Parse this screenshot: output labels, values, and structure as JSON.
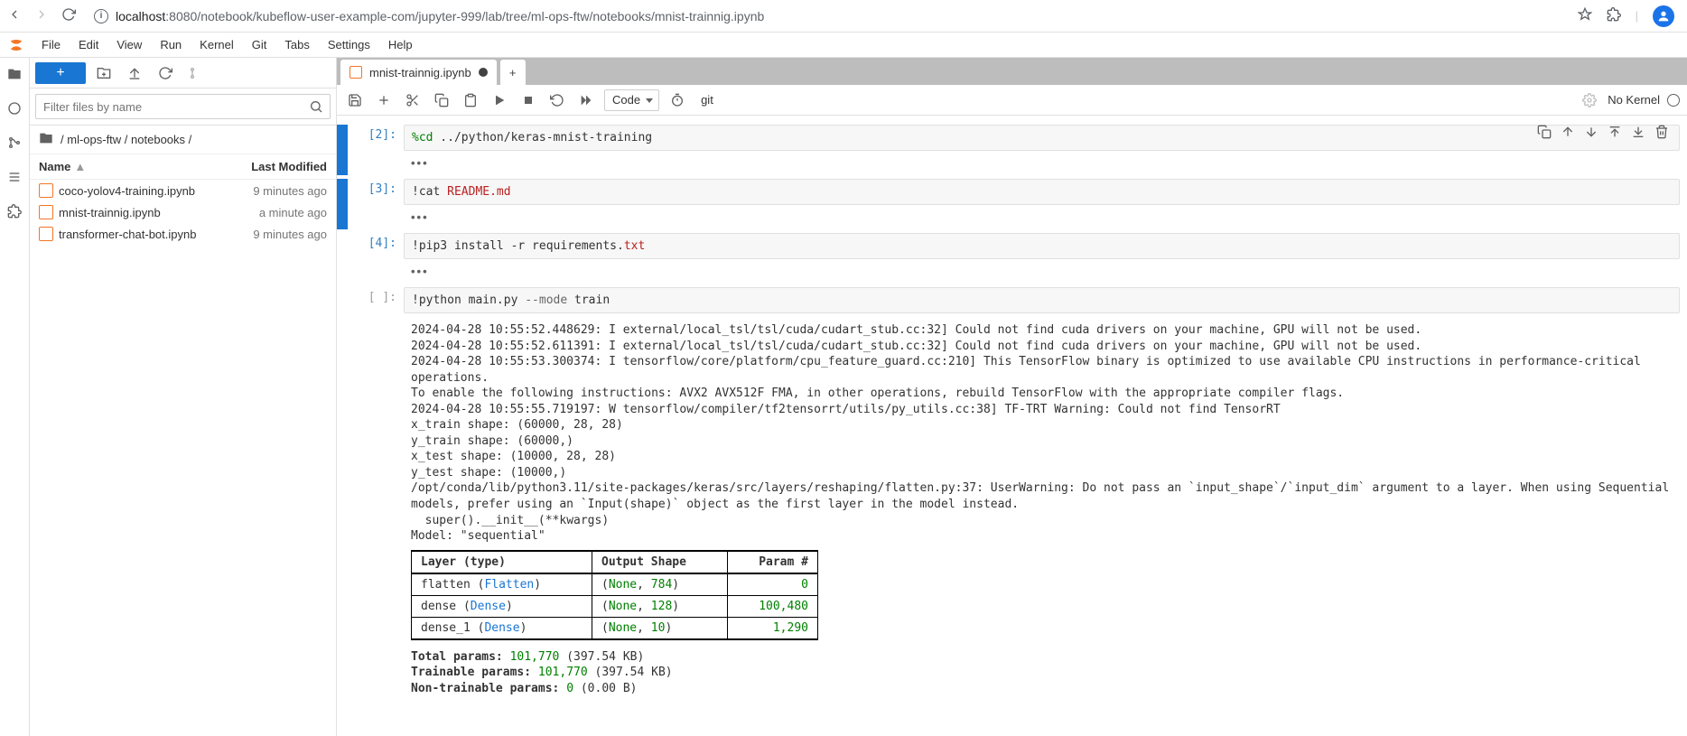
{
  "browser": {
    "url_host": "localhost",
    "url_port_path": ":8080/notebook/kubeflow-user-example-com/jupyter-999/lab/tree/ml-ops-ftw/notebooks/mnist-trainnig.ipynb"
  },
  "menubar": {
    "items": [
      "File",
      "Edit",
      "View",
      "Run",
      "Kernel",
      "Git",
      "Tabs",
      "Settings",
      "Help"
    ]
  },
  "file_panel": {
    "filter_placeholder": "Filter files by name",
    "breadcrumb_parts": [
      "/",
      "ml-ops-ftw",
      "/",
      "notebooks",
      "/"
    ],
    "header_name": "Name",
    "header_modified": "Last Modified",
    "items": [
      {
        "name": "coco-yolov4-training.ipynb",
        "modified": "9 minutes ago"
      },
      {
        "name": "mnist-trainnig.ipynb",
        "modified": "a minute ago"
      },
      {
        "name": "transformer-chat-bot.ipynb",
        "modified": "9 minutes ago"
      }
    ]
  },
  "tab": {
    "title": "mnist-trainnig.ipynb"
  },
  "nb_toolbar": {
    "cell_type": "Code",
    "git_label": "git",
    "kernel_status": "No Kernel"
  },
  "cells": [
    {
      "prompt": "[2]:",
      "code_html": "<span class='cm-magic'>%cd</span> ../python/keras-mnist-training",
      "collapsed": true
    },
    {
      "prompt": "[3]:",
      "code_html": "<span class='cm-bang'>!</span>cat <span class='cm-str'>README.md</span>",
      "collapsed": true
    },
    {
      "prompt": "[4]:",
      "code_html": "<span class='cm-bang'>!</span>pip3 install -r requirements.<span class='cm-str'>txt</span>",
      "collapsed": true
    },
    {
      "prompt": "[ ]:",
      "code_html": "<span class='cm-bang'>!</span>python main.py <span class='cm-opt'>--mode</span> train",
      "collapsed": false
    }
  ],
  "output_lines_pre": "2024-04-28 10:55:52.448629: I external/local_tsl/tsl/cuda/cudart_stub.cc:32] Could not find cuda drivers on your machine, GPU will not be used.\n2024-04-28 10:55:52.611391: I external/local_tsl/tsl/cuda/cudart_stub.cc:32] Could not find cuda drivers on your machine, GPU will not be used.\n2024-04-28 10:55:53.300374: I tensorflow/core/platform/cpu_feature_guard.cc:210] This TensorFlow binary is optimized to use available CPU instructions in performance-critical operations.\nTo enable the following instructions: AVX2 AVX512F FMA, in other operations, rebuild TensorFlow with the appropriate compiler flags.\n2024-04-28 10:55:55.719197: W tensorflow/compiler/tf2tensorrt/utils/py_utils.cc:38] TF-TRT Warning: Could not find TensorRT\nx_train shape: (60000, 28, 28)\ny_train shape: (60000,)\nx_test shape: (10000, 28, 28)\ny_test shape: (10000,)\n/opt/conda/lib/python3.11/site-packages/keras/src/layers/reshaping/flatten.py:37: UserWarning: Do not pass an `input_shape`/`input_dim` argument to a layer. When using Sequential models, prefer using an `Input(shape)` object as the first layer in the model instead.\n  super().__init__(**kwargs)\nModel: \"sequential\"",
  "model_table": {
    "headers": [
      "Layer (type)",
      "Output Shape",
      "Param #"
    ],
    "rows": [
      {
        "layer_name": "flatten",
        "layer_type": "Flatten",
        "shape": "(None, 784)",
        "params": "0"
      },
      {
        "layer_name": "dense",
        "layer_type": "Dense",
        "shape": "(None, 128)",
        "params": "100,480"
      },
      {
        "layer_name": "dense_1",
        "layer_type": "Dense",
        "shape": "(None, 10)",
        "params": "1,290"
      }
    ]
  },
  "params_summary": {
    "total_label": "Total params:",
    "total_value": "101,770",
    "total_size": "(397.54 KB)",
    "trainable_label": "Trainable params:",
    "trainable_value": "101,770",
    "trainable_size": "(397.54 KB)",
    "nontrainable_label": "Non-trainable params:",
    "nontrainable_value": "0",
    "nontrainable_size": "(0.00 B)"
  },
  "collapsed_dots": "•••"
}
